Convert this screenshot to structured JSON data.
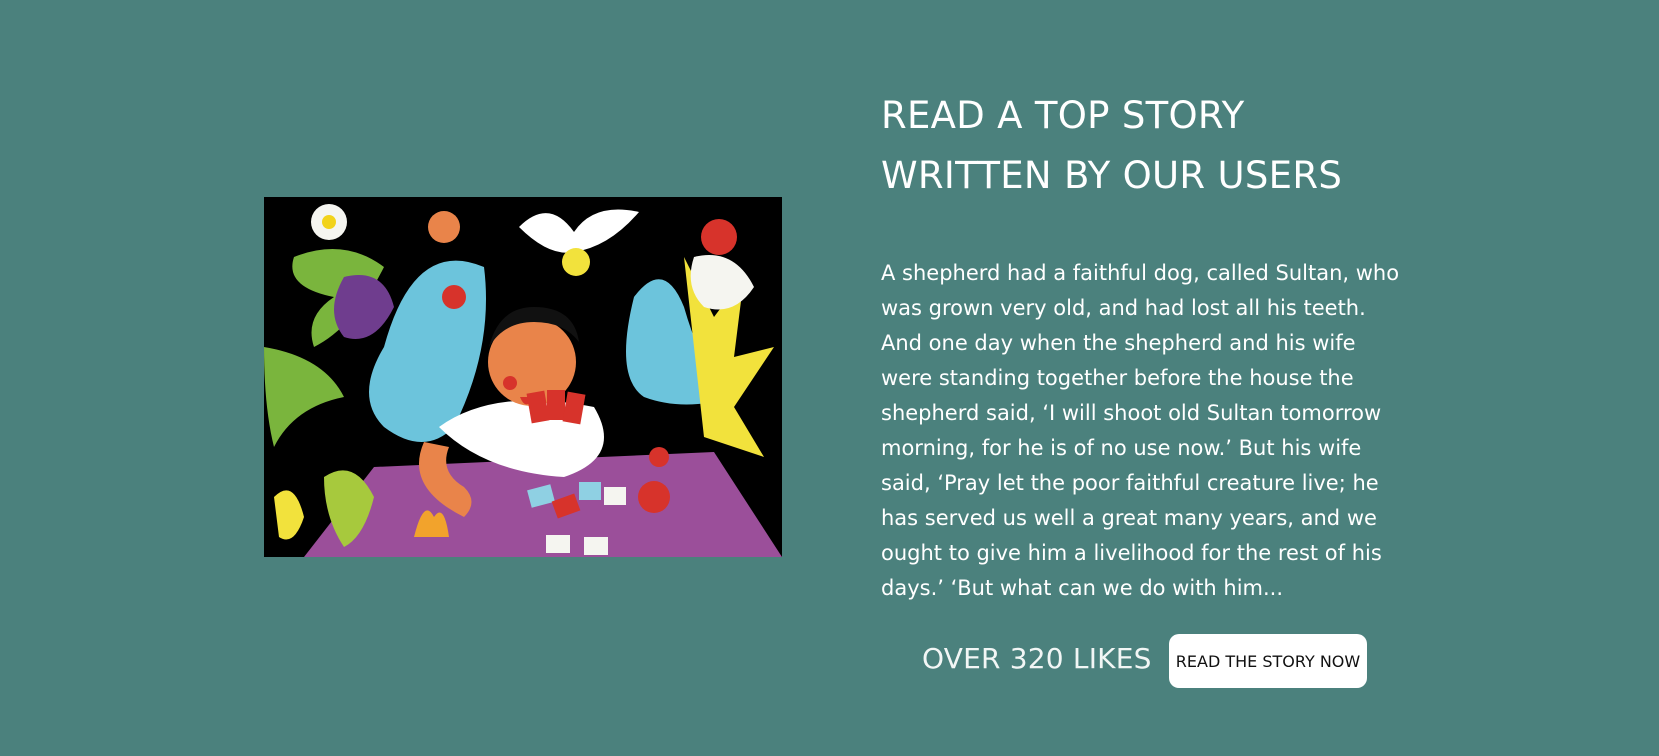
{
  "hero": {
    "title_line_1": "READ A TOP STORY",
    "title_line_2": "WRITTEN BY OUR USERS",
    "excerpt": "A shepherd had a faithful dog, called Sultan, who was grown very old, and had lost all his teeth. And one day when the shepherd and his wife were standing together before the house the shepherd said, ‘I will shoot old Sultan tomorrow morning, for he is of no use now.’ But his wife said, ‘Pray let the poor faithful creature live; he has served us well a great many years, and we ought to give him a livelihood for the rest of his days.’ ‘But what can we do with him...",
    "likes_text": "OVER 320 LIKES",
    "cta_label": "READ THE STORY NOW"
  },
  "colors": {
    "background": "#4b817d",
    "text": "#ffffff",
    "button_bg": "#ffffff",
    "button_text": "#111111"
  }
}
